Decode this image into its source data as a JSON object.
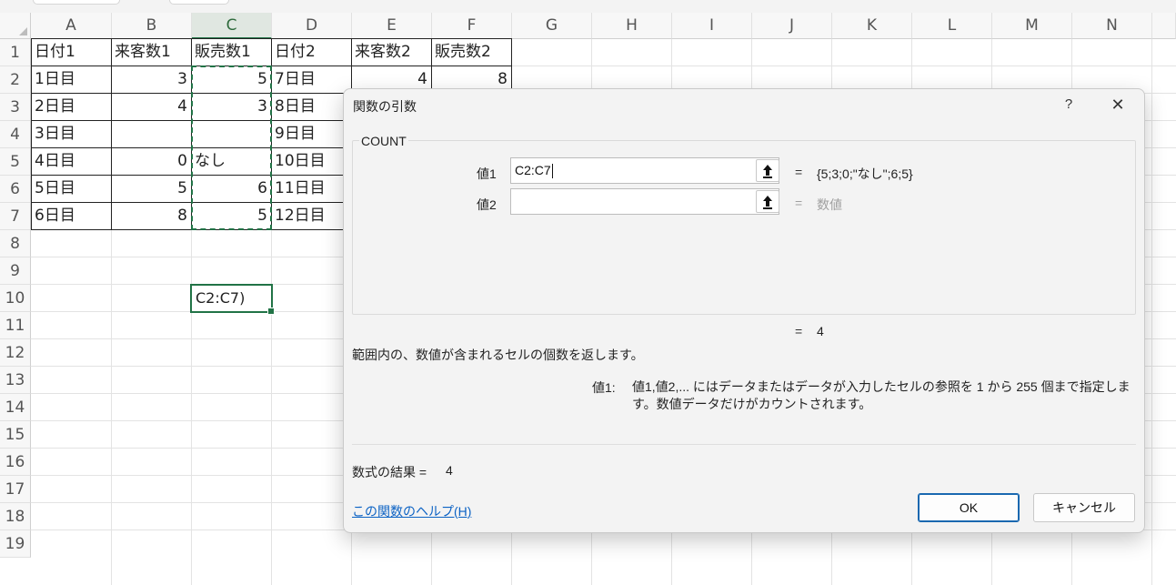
{
  "sheet": {
    "columns": [
      "A",
      "B",
      "C",
      "D",
      "E",
      "F",
      "G",
      "H",
      "I",
      "J",
      "K",
      "L",
      "M",
      "N"
    ],
    "selected_column": "C",
    "rows": [
      "1",
      "2",
      "3",
      "4",
      "5",
      "6",
      "7",
      "8",
      "9",
      "10",
      "11",
      "12",
      "13",
      "14",
      "15",
      "16",
      "17",
      "18",
      "19"
    ],
    "headers": [
      "日付1",
      "来客数1",
      "販売数1",
      "日付2",
      "来客数2",
      "販売数2"
    ],
    "data": [
      [
        "1日目",
        "3",
        "5",
        "7日目",
        "4",
        "8"
      ],
      [
        "2日目",
        "4",
        "3",
        "8日目",
        "",
        ""
      ],
      [
        "3日目",
        "",
        "",
        "9日目",
        "",
        ""
      ],
      [
        "4日目",
        "0",
        "なし",
        "10日目",
        "",
        ""
      ],
      [
        "5日目",
        "5",
        "6",
        "11日目",
        "",
        ""
      ],
      [
        "6日目",
        "8",
        "5",
        "12日目",
        "",
        ""
      ]
    ],
    "active_cell_text": "C2:C7)",
    "accent": "#217346"
  },
  "dialog": {
    "title": "関数の引数",
    "help_glyph": "?",
    "close_glyph": "✕",
    "function_name": "COUNT",
    "arg1_label": "値1",
    "arg1_value": "C2:C7",
    "arg1_result": "{5;3;0;\"なし\";6;5}",
    "arg2_label": "値2",
    "arg2_value": "",
    "arg2_placeholder": "数値",
    "equals": "=",
    "func_result": "4",
    "description": "範囲内の、数値が含まれるセルの個数を返します。",
    "arg_desc_label": "値1:",
    "arg_desc": "値1,値2,... にはデータまたはデータが入力したセルの参照を 1 から 255 個まで指定します。数値データだけがカウントされます。",
    "formula_result_label": "数式の結果 =",
    "formula_result_value": "4",
    "help_link": "この関数のヘルプ(H)",
    "ok_label": "OK",
    "cancel_label": "キャンセル",
    "collapse_icon": "range-select-icon"
  }
}
